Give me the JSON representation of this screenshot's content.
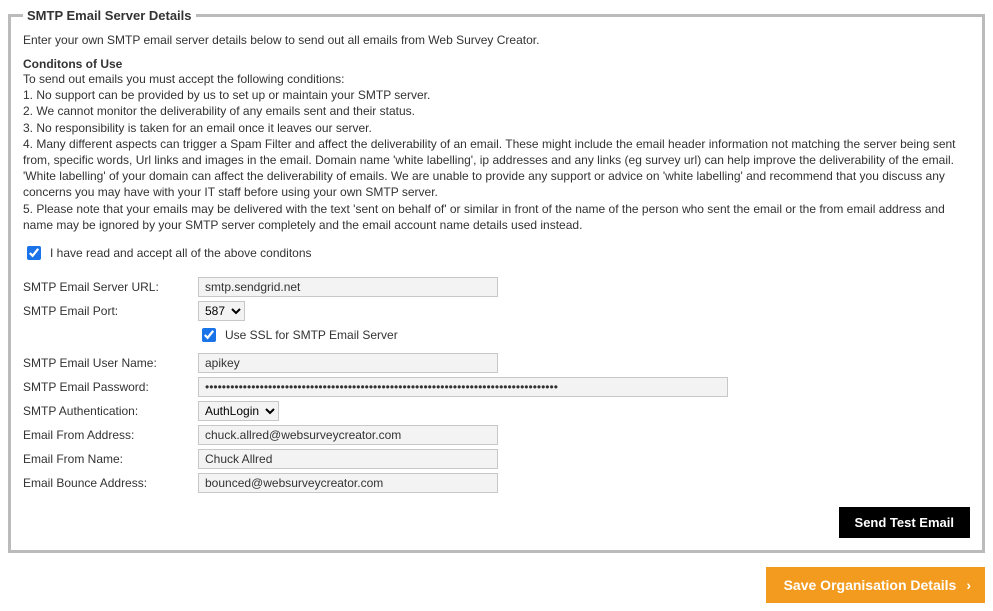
{
  "panel": {
    "legend": "SMTP Email Server Details",
    "intro": "Enter your own SMTP email server details below to send out all emails from Web Survey Creator.",
    "conditions_title": "Conditons of Use",
    "conditions_lines": [
      "To send out emails you must accept the following conditions:",
      "1. No support can be provided by us to set up or maintain your SMTP server.",
      "2. We cannot monitor the deliverability of any emails sent and their status.",
      "3. No responsibility is taken for an email once it leaves our server.",
      "4. Many different aspects can trigger a Spam Filter and affect the deliverability of an email. These might include the email header information not matching the server being sent from, specific words, Url links and images in the email. Domain name 'white labelling', ip addresses and any links (eg survey url) can help improve the deliverability of the email. 'White labelling' of your domain can affect the deliverability of emails. We are unable to provide any support or advice on 'white labelling' and recommend that you discuss any concerns you may have with your IT staff before using your own SMTP server.",
      "5. Please note that your emails may be delivered with the text 'sent on behalf of' or similar in front of the name of the person who sent the email or the from email address and name may be ignored by your SMTP server completely and the email account name details used instead."
    ],
    "accept_label": "I have read and accept all of the above conditons",
    "accept_checked": true
  },
  "form": {
    "server_url": {
      "label": "SMTP Email Server URL:",
      "value": "smtp.sendgrid.net"
    },
    "port": {
      "label": "SMTP Email Port:",
      "value": "587"
    },
    "ssl": {
      "label": "Use SSL for SMTP Email Server",
      "checked": true
    },
    "user": {
      "label": "SMTP Email User Name:",
      "value": "apikey"
    },
    "password": {
      "label": "SMTP Email Password:",
      "value": "••••••••••••••••••••••••••••••••••••••••••••••••••••••••••••••••••••••••••••••••••••"
    },
    "auth": {
      "label": "SMTP Authentication:",
      "value": "AuthLogin"
    },
    "from_addr": {
      "label": "Email From Address:",
      "value": "chuck.allred@websurveycreator.com"
    },
    "from_name": {
      "label": "Email From Name:",
      "value": "Chuck Allred"
    },
    "bounce": {
      "label": "Email Bounce Address:",
      "value": "bounced@websurveycreator.com"
    }
  },
  "buttons": {
    "send_test": "Send Test Email",
    "save_org": "Save Organisation Details"
  }
}
